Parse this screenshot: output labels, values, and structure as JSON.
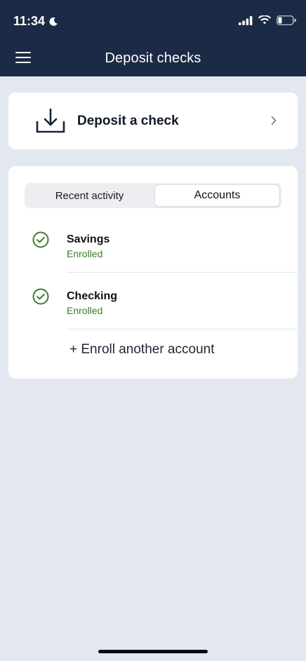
{
  "status_bar": {
    "time": "11:34",
    "icons": [
      "moon-icon",
      "signal-icon",
      "wifi-icon",
      "battery-icon"
    ]
  },
  "header": {
    "title": "Deposit checks",
    "menu_icon": "hamburger-menu-icon"
  },
  "deposit_card": {
    "label": "Deposit a check",
    "icon": "download-tray-icon"
  },
  "tabs": {
    "recent": "Recent activity",
    "accounts": "Accounts",
    "selected": "Accounts"
  },
  "accounts": [
    {
      "name": "Savings",
      "status": "Enrolled"
    },
    {
      "name": "Checking",
      "status": "Enrolled"
    }
  ],
  "enroll_link": "+ Enroll another account",
  "colors": {
    "header_bg": "#1b2a45",
    "page_bg": "#e3e7ef",
    "enrolled_green": "#3b7d2a"
  }
}
